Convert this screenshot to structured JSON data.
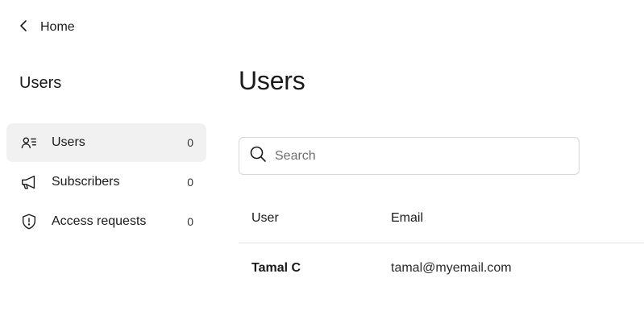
{
  "back_link": {
    "label": "Home",
    "icon": "chevron-left-icon"
  },
  "sidebar": {
    "title": "Users",
    "items": [
      {
        "label": "Users",
        "count": "0",
        "icon": "users-list-icon",
        "active": true
      },
      {
        "label": "Subscribers",
        "count": "0",
        "icon": "megaphone-icon",
        "active": false
      },
      {
        "label": "Access requests",
        "count": "0",
        "icon": "shield-alert-icon",
        "active": false
      }
    ]
  },
  "main": {
    "title": "Users",
    "search": {
      "placeholder": "Search",
      "value": ""
    },
    "table": {
      "columns": [
        "User",
        "Email"
      ],
      "rows": [
        {
          "user": "Tamal C",
          "email": "tamal@myemail.com"
        }
      ]
    }
  },
  "colors": {
    "active_item_bg": "#f1f1f1",
    "border": "#d6d6d6",
    "text": "#1a1a1a"
  }
}
